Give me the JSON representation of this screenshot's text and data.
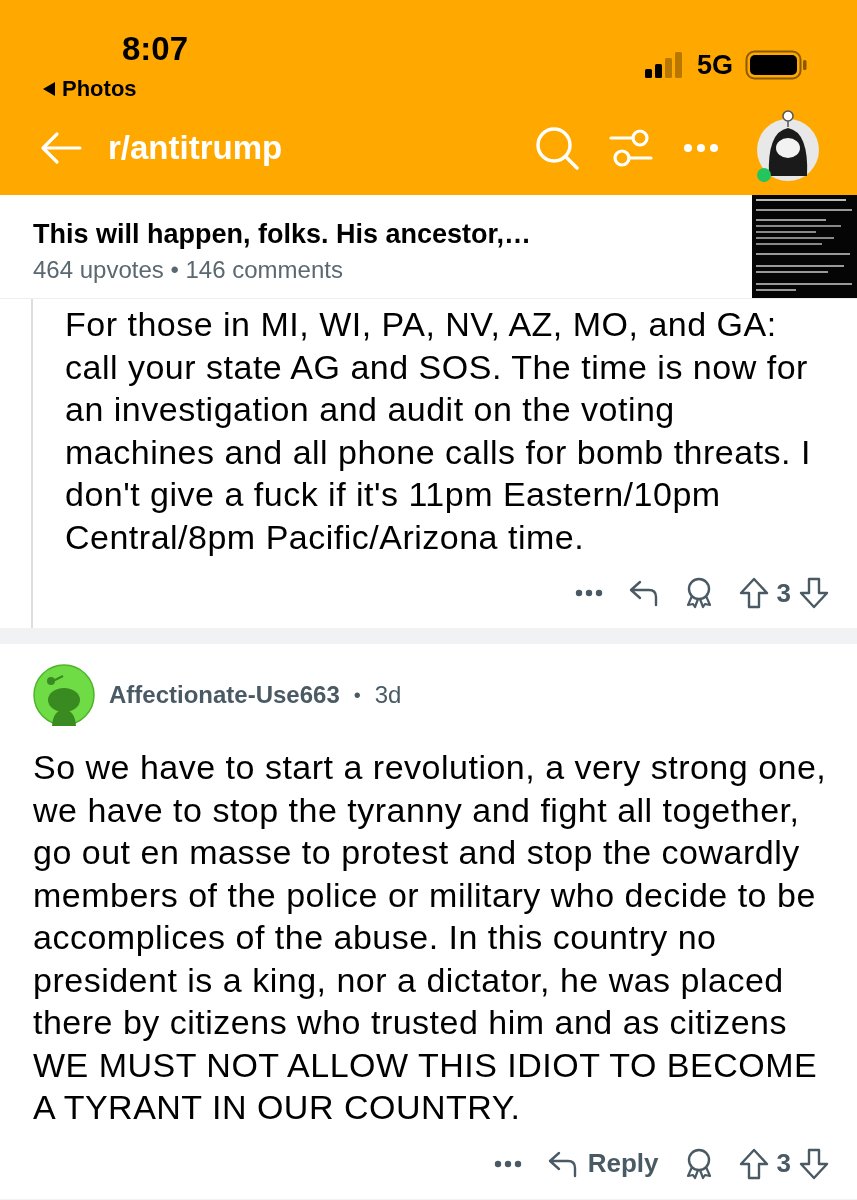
{
  "status_bar": {
    "time": "8:07",
    "back_app": "Photos",
    "network": "5G"
  },
  "nav": {
    "title": "r/antitrump"
  },
  "post": {
    "title": "This will happen, folks. His ancestor,…",
    "meta": "464 upvotes • 146 comments"
  },
  "comments": [
    {
      "threaded": true,
      "body": "For those in MI, WI, PA, NV, AZ, MO, and GA: call your state AG and SOS. The time is now for an investigation and audit on the voting machines and all phone calls for bomb threats. I don't give a fuck if it's 11pm Eastern/10pm Central/8pm Pacific/Arizona time.",
      "score": "3"
    },
    {
      "threaded": false,
      "author": "Affectionate-Use663",
      "dot": "•",
      "age": "3d",
      "body": "So we have to start a revolution, a very strong one, we have to stop the tyranny and fight all together, go out en masse to protest and stop the cowardly members of the police or military who decide to be accomplices of the abuse. In this country no president is a king, nor a dictator, he was placed there by citizens who trusted him and as citizens WE MUST NOT ALLOW THIS IDIOT TO BECOME A TYRANT IN OUR COUNTRY.",
      "reply_label": "Reply",
      "score": "3"
    }
  ]
}
